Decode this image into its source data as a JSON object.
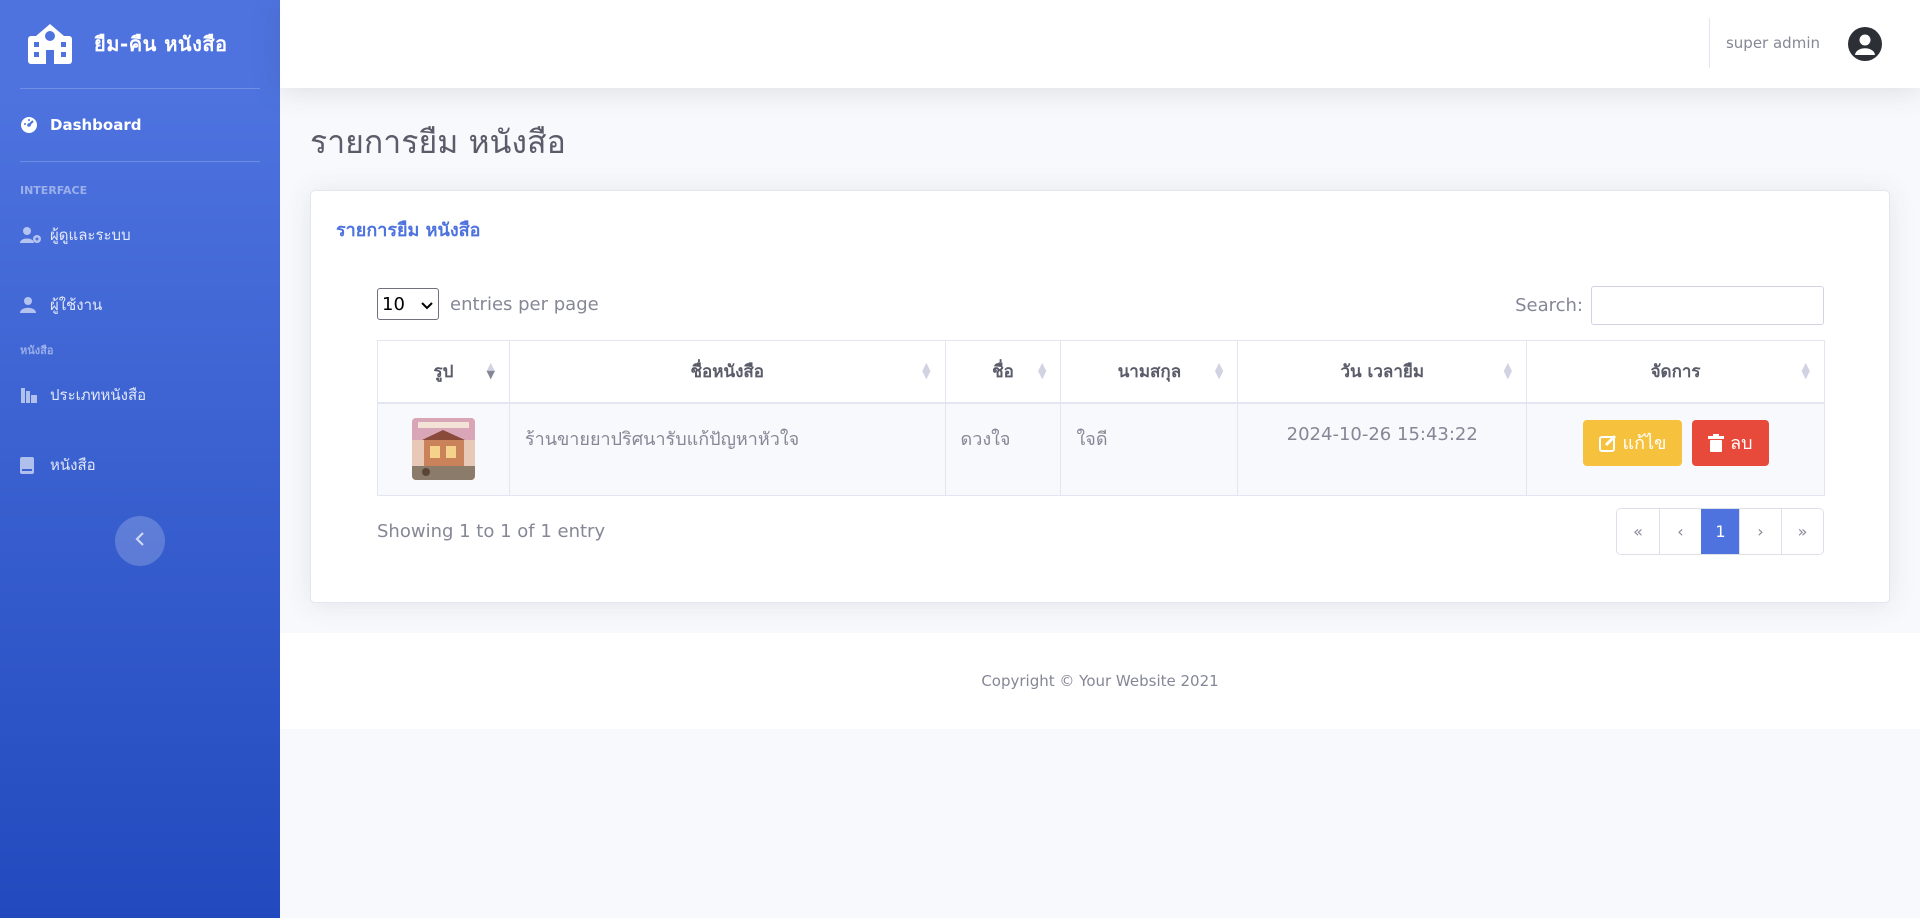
{
  "brand": {
    "title": "ยืม-คืน หนังสือ",
    "icon": "school-icon"
  },
  "sidebar": {
    "dashboard_label": "Dashboard",
    "heading_interface": "INTERFACE",
    "item_admin": "ผู้ดูและระบบ",
    "item_users": "ผู้ใช้งาน",
    "heading_books": "หนังสือ",
    "item_book_types": "ประเภทหนังสือ",
    "item_books": "หนังสือ"
  },
  "topbar": {
    "user_name": "super admin"
  },
  "page": {
    "title": "รายการยืม หนังสือ"
  },
  "card": {
    "title": "รายการยืม หนังสือ"
  },
  "table_controls": {
    "page_size": "10",
    "entries_label": "entries per page",
    "search_label": "Search:"
  },
  "table": {
    "columns": [
      "รูป",
      "ชื่อหนังสือ",
      "ชื่อ",
      "นามสกุล",
      "วัน เวลายืม",
      "จัดการ"
    ],
    "rows": [
      {
        "book_name": "ร้านขายยาปริศนารับแก้ปัญหาหัวใจ",
        "first_name": "ดวงใจ",
        "last_name": "ใจดี",
        "borrow_datetime": "2024-10-26 15:43:22",
        "edit_label": "แก้ไข",
        "delete_label": "ลบ"
      }
    ]
  },
  "pagination": {
    "info": "Showing 1 to 1 of 1 entry",
    "first": "«",
    "prev": "‹",
    "current": "1",
    "next": "›",
    "last": "»"
  },
  "footer": {
    "copyright": "Copyright © Your Website 2021"
  },
  "colors": {
    "primary": "#4e73df",
    "warning": "#f6c23e",
    "danger": "#e74a3b"
  }
}
